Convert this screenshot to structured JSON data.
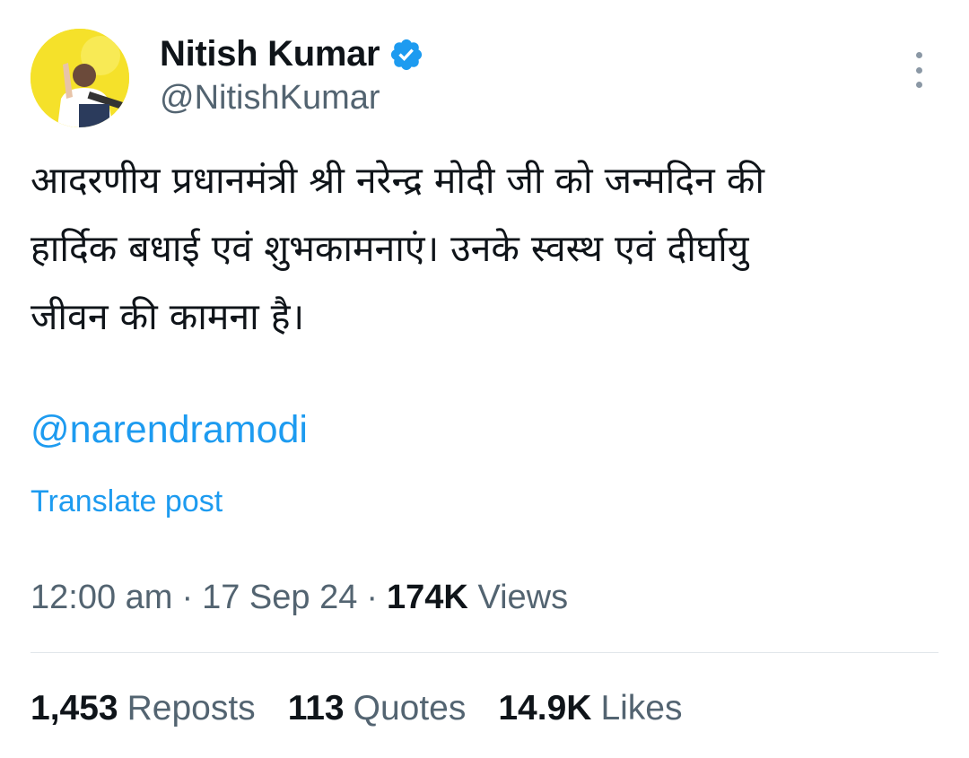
{
  "author": {
    "display_name": "Nitish Kumar",
    "handle": "@NitishKumar",
    "verified": true,
    "avatar_icon": "profile-photo",
    "avatar_bg": "#f5e12a"
  },
  "tweet": {
    "text": "आदरणीय प्रधानमंत्री श्री नरेन्द्र मोदी जी को जन्मदिन की\nहार्दिक बधाई एवं शुभकामनाएं। उनके स्वस्थ एवं दीर्घायु\nजीवन की कामना है।",
    "mention": "@narendramodi",
    "translate_label": "Translate post"
  },
  "meta": {
    "time": "12:00 am",
    "sep1": "·",
    "date": "17 Sep 24",
    "sep2": "·",
    "views_count": "174K",
    "views_label": "Views"
  },
  "stats": {
    "reposts_count": "1,453",
    "reposts_label": "Reposts",
    "quotes_count": "113",
    "quotes_label": "Quotes",
    "likes_count": "14.9K",
    "likes_label": "Likes"
  },
  "colors": {
    "link": "#1d9bf0",
    "secondary_text": "#536471",
    "primary_text": "#0f1419"
  }
}
